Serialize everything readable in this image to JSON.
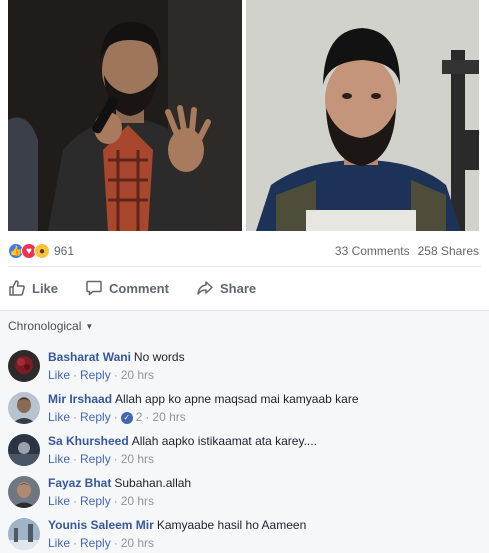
{
  "reactions": {
    "count": "961",
    "types": [
      "like-icon",
      "love-icon",
      "wow-icon"
    ]
  },
  "stats": {
    "comments": "33 Comments",
    "shares": "258 Shares"
  },
  "actions": {
    "like": "Like",
    "comment": "Comment",
    "share": "Share"
  },
  "sort_label": "Chronological",
  "comment_meta": {
    "like": "Like",
    "reply": "Reply"
  },
  "comments": [
    {
      "author": "Basharat Wani",
      "text": "No words",
      "time": "20 hrs",
      "likes": ""
    },
    {
      "author": "Mir Irshaad",
      "text": "Allah app ko apne maqsad mai kamyaab kare",
      "time": "20 hrs",
      "likes": "2"
    },
    {
      "author": "Sa Khursheed",
      "text": "Allah aapko istikaamat ata karey....",
      "time": "20 hrs",
      "likes": ""
    },
    {
      "author": "Fayaz Bhat",
      "text": "Subahan.allah",
      "time": "20 hrs",
      "likes": ""
    },
    {
      "author": "Younis Saleem Mir",
      "text": "Kamyaabe hasil ho Aameen",
      "time": "20 hrs",
      "likes": ""
    }
  ],
  "colors": {
    "link_blue": "#365899",
    "meta_grey": "#90949c",
    "panel_bg": "#f6f7f9"
  }
}
